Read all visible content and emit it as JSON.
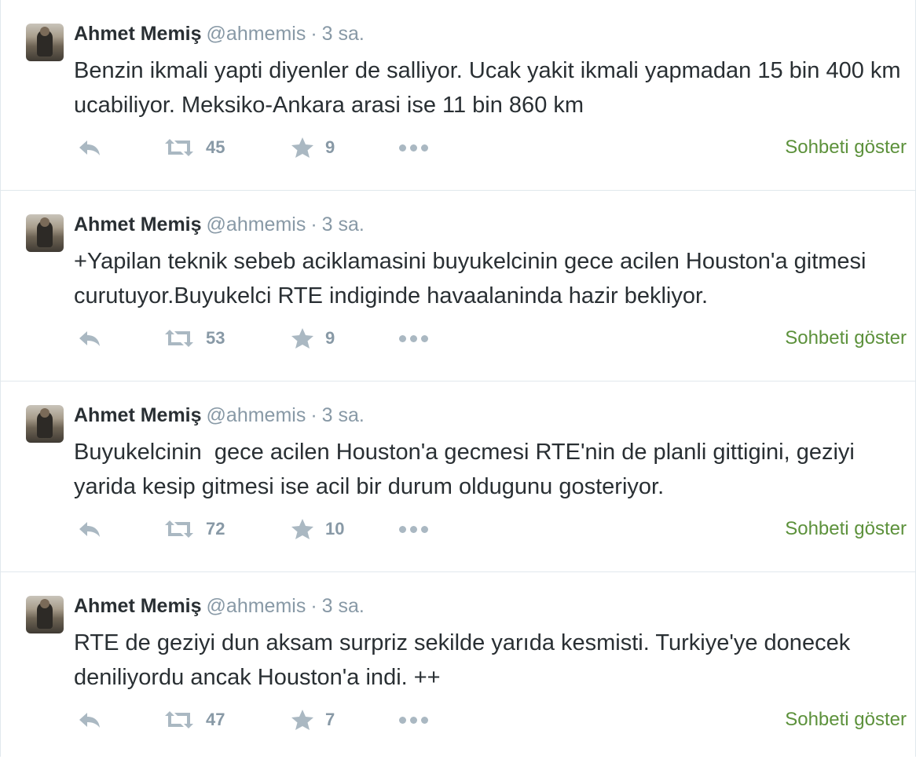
{
  "colors": {
    "link": "#5c913b",
    "muted": "#8899a6",
    "icon": "#aab8c2",
    "text": "#292f33"
  },
  "tweets": [
    {
      "name": "Ahmet Memiş",
      "handle": "@ahmemis",
      "sep": "·",
      "time": "3 sa.",
      "text": "Benzin ikmali yapti diyenler de salliyor. Ucak yakit ikmali yapmadan 15 bin 400 km ucabiliyor. Meksiko-Ankara arasi ise 11 bin 860 km",
      "retweets": "45",
      "likes": "9",
      "conversation": "Sohbeti göster"
    },
    {
      "name": "Ahmet Memiş",
      "handle": "@ahmemis",
      "sep": "·",
      "time": "3 sa.",
      "text": "+Yapilan teknik sebeb aciklamasini buyukelcinin gece acilen Houston'a gitmesi curutuyor.Buyukelci RTE indiginde havaalaninda hazir bekliyor.",
      "retweets": "53",
      "likes": "9",
      "conversation": "Sohbeti göster"
    },
    {
      "name": "Ahmet Memiş",
      "handle": "@ahmemis",
      "sep": "·",
      "time": "3 sa.",
      "text": "Buyukelcinin  gece acilen Houston'a gecmesi RTE'nin de planli gittigini, geziyi yarida kesip gitmesi ise acil bir durum oldugunu gosteriyor.",
      "retweets": "72",
      "likes": "10",
      "conversation": "Sohbeti göster"
    },
    {
      "name": "Ahmet Memiş",
      "handle": "@ahmemis",
      "sep": "·",
      "time": "3 sa.",
      "text": "RTE de geziyi dun aksam surpriz sekilde yarıda kesmisti. Turkiye'ye donecek deniliyordu ancak Houston'a indi. ++",
      "retweets": "47",
      "likes": "7",
      "conversation": "Sohbeti göster"
    }
  ]
}
